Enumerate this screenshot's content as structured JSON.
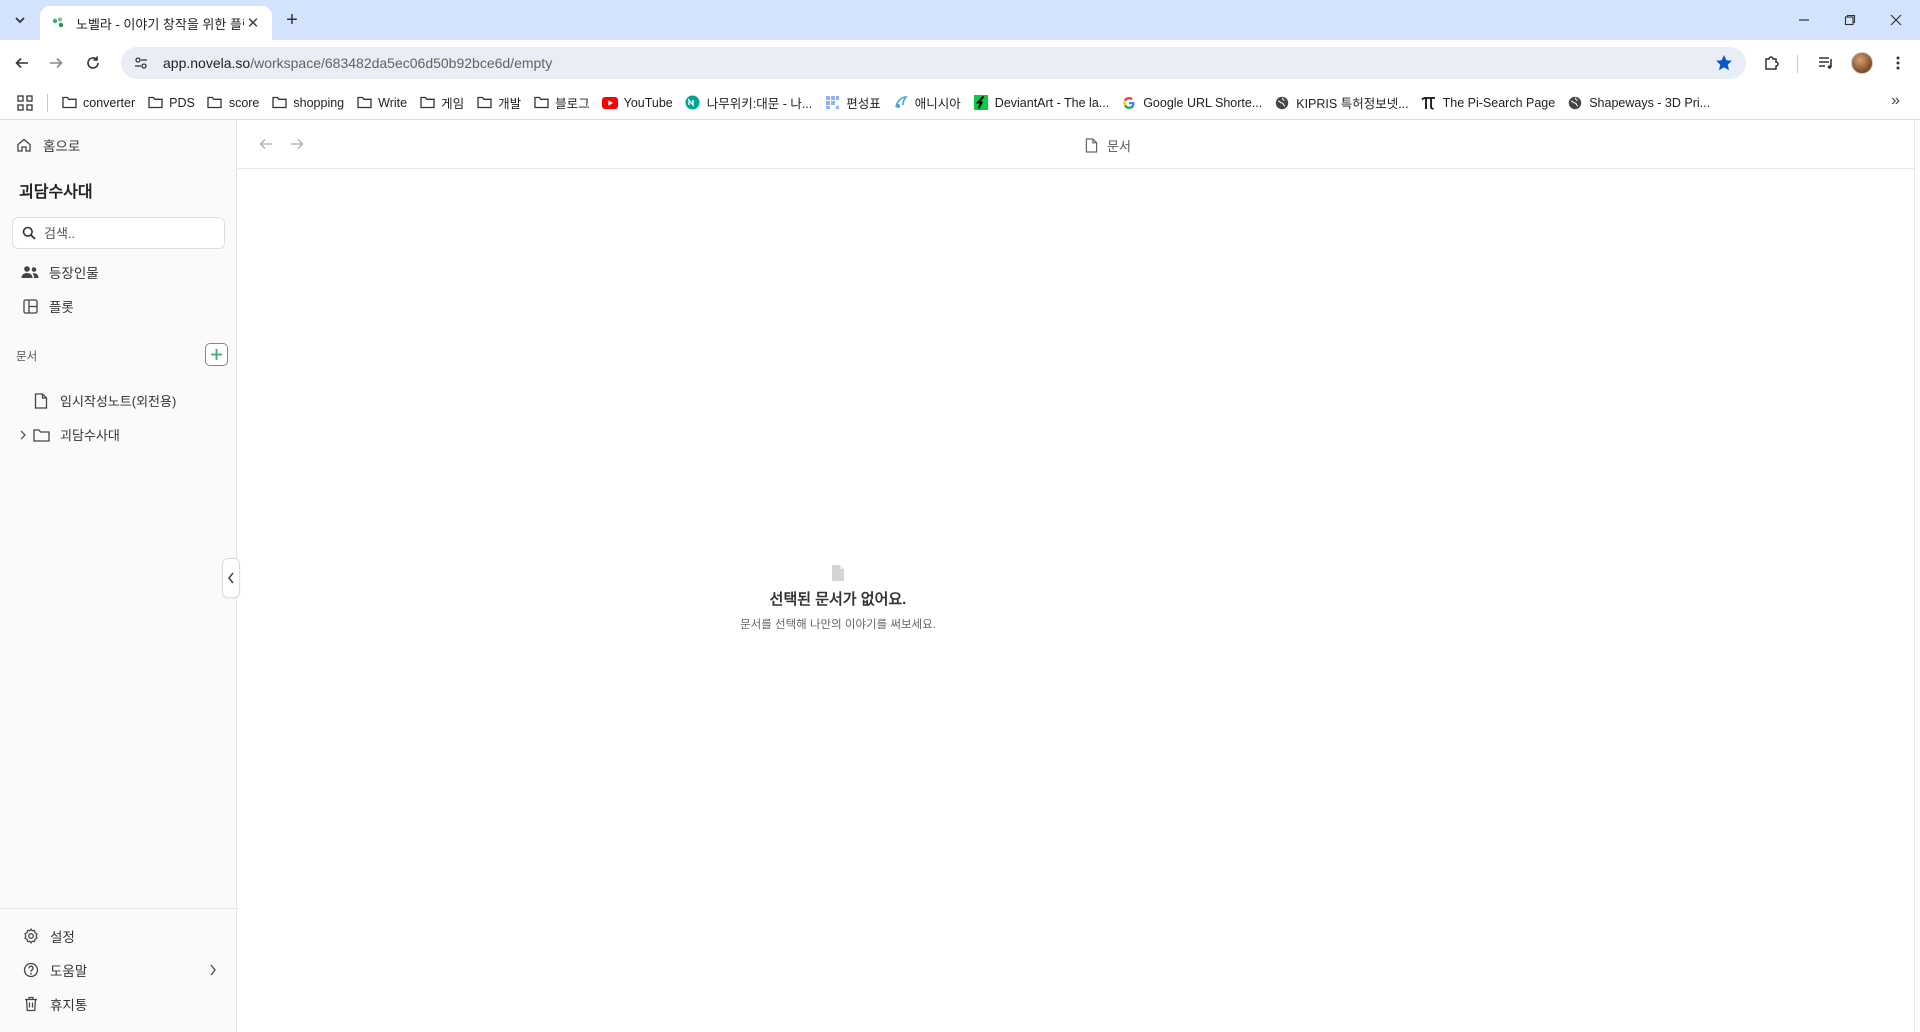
{
  "browser": {
    "tab_title": "노벨라 - 이야기 창작을 위한 플랫폼",
    "url_host": "app.novela.so",
    "url_path": "/workspace/683482da5ec06d50b92bce6d/empty",
    "bookmarks": [
      {
        "label": "converter",
        "icon": "folder-icon"
      },
      {
        "label": "PDS",
        "icon": "folder-icon"
      },
      {
        "label": "score",
        "icon": "folder-icon"
      },
      {
        "label": "shopping",
        "icon": "folder-icon"
      },
      {
        "label": "Write",
        "icon": "folder-icon"
      },
      {
        "label": "게임",
        "icon": "folder-icon"
      },
      {
        "label": "개발",
        "icon": "folder-icon"
      },
      {
        "label": "블로그",
        "icon": "folder-icon"
      },
      {
        "label": "YouTube",
        "icon": "youtube-icon"
      },
      {
        "label": "나무위키:대문 - 나...",
        "icon": "namuwiki-icon"
      },
      {
        "label": "편성표",
        "icon": "grid-icon"
      },
      {
        "label": "애니시아",
        "icon": "anissia-icon"
      },
      {
        "label": "DeviantArt - The la...",
        "icon": "deviantart-icon"
      },
      {
        "label": "Google URL Shorte...",
        "icon": "google-icon"
      },
      {
        "label": "KIPRIS 특허정보넷...",
        "icon": "globe-icon"
      },
      {
        "label": "The Pi-Search Page",
        "icon": "pi-icon"
      },
      {
        "label": "Shapeways - 3D Pri...",
        "icon": "globe-icon"
      }
    ]
  },
  "sidebar": {
    "home_label": "홈으로",
    "workspace_title": "괴담수사대",
    "search_placeholder": "검색..",
    "nav": [
      {
        "label": "등장인물",
        "icon": "people-icon"
      },
      {
        "label": "플롯",
        "icon": "board-icon"
      }
    ],
    "docs_section_label": "문서",
    "docs": [
      {
        "label": "임시작성노트(외전용)",
        "type": "file"
      },
      {
        "label": "괴담수사대",
        "type": "folder"
      }
    ],
    "footer": {
      "settings": "설정",
      "help": "도움말",
      "trash": "휴지통"
    }
  },
  "main": {
    "header_title": "문서",
    "empty_title": "선택된 문서가 없어요.",
    "empty_subtitle": "문서를 선택해 나만의 이야기를 써보세요."
  },
  "colors": {
    "accent": "#3fae72",
    "tabstrip": "#d3e3fd",
    "star": "#0b57d0"
  }
}
